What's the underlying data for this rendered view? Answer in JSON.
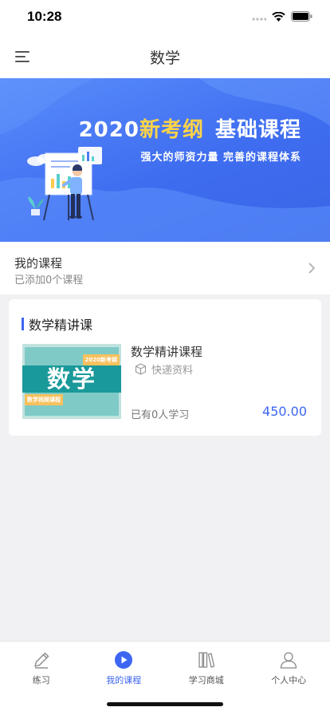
{
  "status_bar": {
    "time": "10:28"
  },
  "nav": {
    "title": "数学",
    "menu_icon": "menu-icon"
  },
  "banner": {
    "title_year": "2020",
    "title_accent": "新考纲",
    "title_rest": "基础课程",
    "subtitle": "强大的师资力量 完善的课程体系",
    "accent_color": "#ffd447"
  },
  "my_course": {
    "title": "我的课程",
    "subtitle": "已添加0个课程"
  },
  "section": {
    "title": "数学精讲课",
    "accent_color": "#3d66f1",
    "course": {
      "thumb_badge_top": "2020新考纲",
      "thumb_big_text": "数学",
      "thumb_badge_bottom": "数学视频课程",
      "name": "数学精讲课程",
      "materials": "快递资料",
      "learners": "已有0人学习",
      "price": "450.00"
    }
  },
  "tabs": [
    {
      "label": "练习",
      "icon": "pencil-icon",
      "active": false
    },
    {
      "label": "我的课程",
      "icon": "play-icon",
      "active": true
    },
    {
      "label": "学习商城",
      "icon": "books-icon",
      "active": false
    },
    {
      "label": "个人中心",
      "icon": "person-icon",
      "active": false
    }
  ]
}
